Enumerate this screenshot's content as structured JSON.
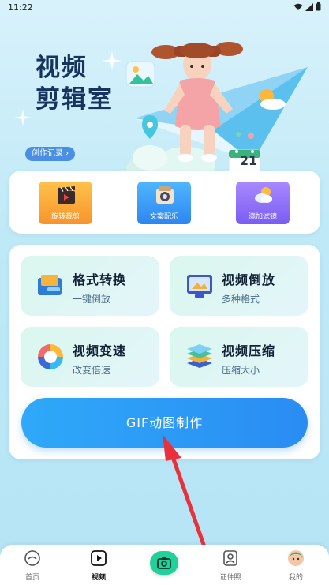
{
  "status_bar": {
    "time": "11:22"
  },
  "hero": {
    "title_line1": "视频",
    "title_line2": "剪辑室",
    "record_button": "创作记录 ›",
    "calendar_day": "21"
  },
  "quick_actions": [
    {
      "label": "旋转裁剪",
      "icon": "clapperboard-icon"
    },
    {
      "label": "文案配乐",
      "icon": "music-box-icon"
    },
    {
      "label": "添加滤镜",
      "icon": "weather-icon"
    }
  ],
  "tools": [
    {
      "title": "格式转换",
      "subtitle": "一键倒放",
      "icon": "format-convert-icon"
    },
    {
      "title": "视频倒放",
      "subtitle": "多种格式",
      "icon": "monitor-icon"
    },
    {
      "title": "视频变速",
      "subtitle": "改变倍速",
      "icon": "speed-wheel-icon"
    },
    {
      "title": "视频压缩",
      "subtitle": "压缩大小",
      "icon": "layers-icon"
    }
  ],
  "gif_button": "GIF动图制作",
  "nav": {
    "items": [
      {
        "label": "首页",
        "icon": "home-icon"
      },
      {
        "label": "视频",
        "icon": "play-icon",
        "active": true
      },
      {
        "label": "",
        "icon": "camera-icon"
      },
      {
        "label": "证件照",
        "icon": "id-photo-icon"
      },
      {
        "label": "我的",
        "icon": "profile-icon"
      }
    ]
  },
  "colors": {
    "accent": "#2a8cf3",
    "camera": "#1fd29b",
    "annotation_arrow": "#e8313a"
  }
}
